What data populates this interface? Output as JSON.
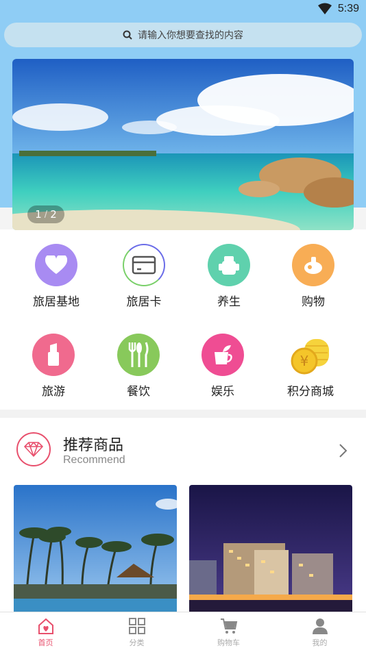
{
  "status_bar": {
    "time": "5:39"
  },
  "search": {
    "placeholder": "请输入你想要查找的内容"
  },
  "banner": {
    "page_current": "1",
    "page_separator": "/",
    "page_total": "2"
  },
  "categories": [
    {
      "label": "旅居基地",
      "icon": "heart-icon",
      "color": "#a88bf2"
    },
    {
      "label": "旅居卡",
      "icon": "card-icon",
      "color": "#ffffff"
    },
    {
      "label": "养生",
      "icon": "cup-icon",
      "color": "#5fd1ad"
    },
    {
      "label": "购物",
      "icon": "basket-icon",
      "color": "#f8ad55"
    },
    {
      "label": "旅游",
      "icon": "lipstick-icon",
      "color": "#f06a8e"
    },
    {
      "label": "餐饮",
      "icon": "cutlery-icon",
      "color": "#88c95b"
    },
    {
      "label": "娱乐",
      "icon": "drink-icon",
      "color": "#ef4d93"
    },
    {
      "label": "积分商城",
      "icon": "coins-icon",
      "color": "#f6d33c"
    }
  ],
  "recommend": {
    "title": "推荐商品",
    "subtitle": "Recommend"
  },
  "tabbar": [
    {
      "label": "首页",
      "icon": "home-icon",
      "active": true
    },
    {
      "label": "分类",
      "icon": "grid-icon",
      "active": false
    },
    {
      "label": "购物车",
      "icon": "cart-icon",
      "active": false
    },
    {
      "label": "我的",
      "icon": "user-icon",
      "active": false
    }
  ],
  "colors": {
    "header": "#8fcdf5",
    "accent": "#e8506d"
  }
}
